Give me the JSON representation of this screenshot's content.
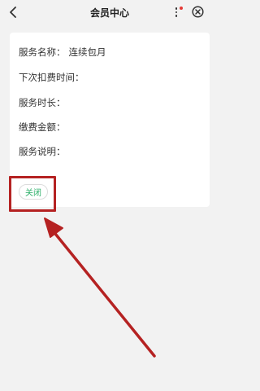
{
  "header": {
    "title": "会员中心"
  },
  "service": {
    "rows": [
      {
        "label": "服务名称：",
        "value": "连续包月"
      },
      {
        "label": "下次扣费时间：",
        "value": ""
      },
      {
        "label": "服务时长：",
        "value": ""
      },
      {
        "label": "缴费金额：",
        "value": ""
      },
      {
        "label": "服务说明：",
        "value": ""
      }
    ],
    "close_label": "关闭"
  },
  "colors": {
    "accent_green": "#2aae67",
    "highlight_red": "#b52222",
    "notification_red": "#e53935"
  },
  "icons": {
    "back": "chevron-left-icon",
    "more": "more-vertical-icon",
    "close": "close-circle-icon"
  }
}
